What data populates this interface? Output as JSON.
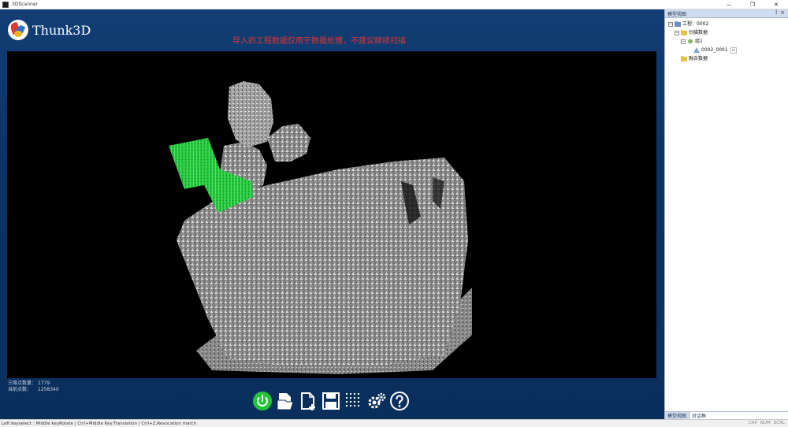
{
  "window": {
    "title": "3DScanner",
    "minimize": "—",
    "restore": "❐",
    "close": "✕"
  },
  "brand": {
    "logo_text": "Thunk3D"
  },
  "notice": "导入的工程数据仅用于数据处理，不建议继续扫描",
  "stats": {
    "points_label": "三维点数量：",
    "points_value": "1779",
    "current_label": "当前点数：",
    "current_value": "1258340"
  },
  "toolbar": {
    "items": [
      {
        "name": "power",
        "icon": "power-icon"
      },
      {
        "name": "open-project",
        "icon": "open-file-icon"
      },
      {
        "name": "new-project",
        "icon": "new-file-icon"
      },
      {
        "name": "save",
        "icon": "save-icon"
      },
      {
        "name": "point-grid",
        "icon": "grid-icon"
      },
      {
        "name": "settings",
        "icon": "gear-icon"
      },
      {
        "name": "help",
        "icon": "help-icon"
      }
    ]
  },
  "statusbar": {
    "text": "Left keyselect : Middle keyRotate | Ctrl+Middle Key:Translation | Ctrl+Z:Revocation match",
    "right": [
      "CAP",
      "NUM",
      "SCRL"
    ]
  },
  "panel": {
    "title": "模型视图",
    "pin": "ꟾ",
    "close": "×",
    "tree": {
      "project_label": "工程：0002",
      "scan_data": "扫描数据",
      "group": "组1",
      "scan_item": "0002_0001",
      "scan_item_tag": "m",
      "fusion_data": "融合数据"
    },
    "tabs": [
      "模型视图",
      "对话框"
    ]
  },
  "colors": {
    "accent_green": "#22c43a",
    "warning_red": "#e0342e",
    "background_blue": "#0c3263"
  }
}
